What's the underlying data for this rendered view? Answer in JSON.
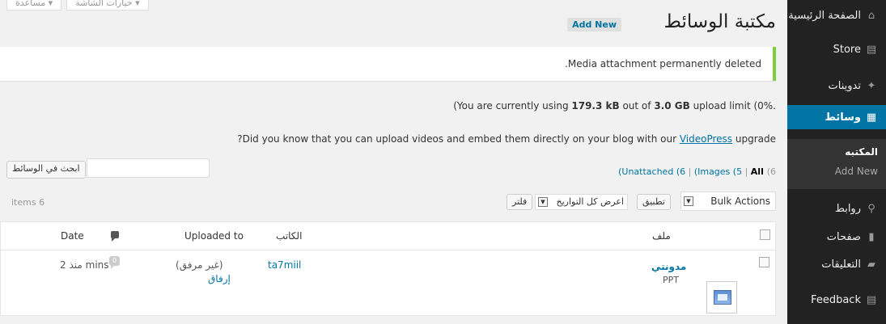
{
  "sidebar": {
    "items": [
      {
        "label": "الصفحة الرئيسية",
        "icon": "home-icon",
        "glyph": "⌂"
      },
      {
        "label": "Store",
        "icon": "cart-icon",
        "glyph": "🛒"
      },
      {
        "label": "تدوينات",
        "icon": "pin-icon",
        "glyph": "✦"
      },
      {
        "label": "وسائط",
        "icon": "media-icon",
        "glyph": "▦"
      },
      {
        "label": "روابط",
        "icon": "link-icon",
        "glyph": "⚲"
      },
      {
        "label": "صفحات",
        "icon": "page-icon",
        "glyph": "▮"
      },
      {
        "label": "التعليقات",
        "icon": "comment-icon",
        "glyph": "▰"
      },
      {
        "label": "Feedback",
        "icon": "feedback-icon",
        "glyph": "▤"
      }
    ],
    "submenu": [
      "المكتبه",
      "Add New"
    ]
  },
  "screen_tabs": [
    "خيارات الشاشة ▾",
    "مساعدة ▾"
  ],
  "header": {
    "title": "مكتبة الوسائط",
    "add_new": "Add New"
  },
  "notice": ".Media attachment permanently deleted",
  "usage": {
    "prefix": "(You are currently using ",
    "used": "179.3 kB",
    "middle": " out of ",
    "limit": "3.0 GB",
    "suffix": " upload limit (0%."
  },
  "videopress": {
    "before": "?Did you know that you can upload videos and embed them directly on your blog with our ",
    "link": "VideoPress",
    "after": " upgrade"
  },
  "search": {
    "button": "ابحث في الوسائط",
    "placeholder": ""
  },
  "filters": {
    "all": "All",
    "all_count": "(6",
    "images": "(Images",
    "images_count": "(5",
    "unattached": "(Unattached",
    "unattached_count": "(6",
    "sep": " | "
  },
  "toolbar": {
    "bulk_actions": "Bulk Actions",
    "apply": "تطبيق",
    "dates": "اعرض كل التواريخ",
    "filter": "فلتر"
  },
  "items_count": "items 6",
  "table": {
    "headers": {
      "file": "ملف",
      "author": "الكاتب",
      "uploaded_to": "Uploaded to",
      "date": "Date"
    },
    "rows": [
      {
        "title": "مدونتي",
        "type": "PPT",
        "author": "ta7miil",
        "uploaded": "(غير مرفق)",
        "attach": "إرفاق",
        "comments": "0",
        "date": "منذ 2 mins"
      }
    ]
  },
  "colors": {
    "sidebar_bg": "#222222",
    "active": "#0074a2",
    "notice_border": "#7ad03a",
    "link": "#0074a2"
  }
}
